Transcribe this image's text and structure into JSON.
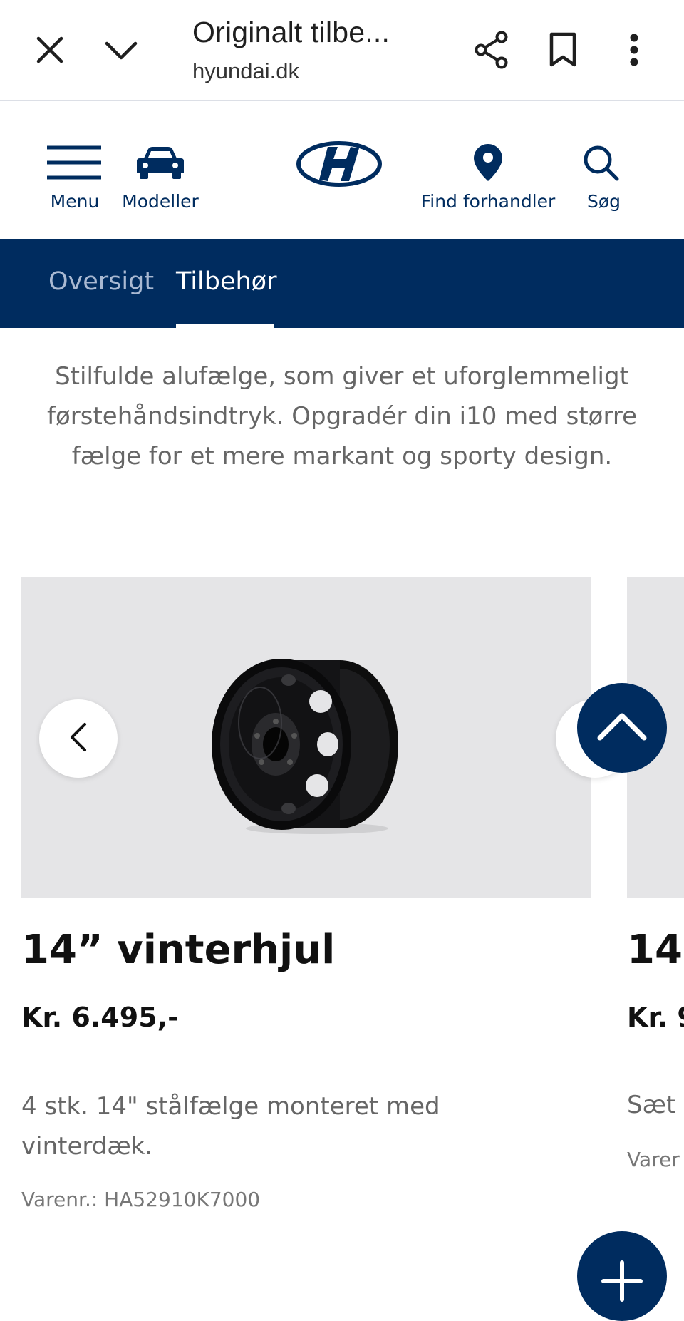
{
  "browser": {
    "title": "Originalt tilbe...",
    "url": "hyundai.dk",
    "icons": [
      "close-icon",
      "chevron-down-icon",
      "share-icon",
      "bookmark-icon",
      "more-vert-icon"
    ]
  },
  "header": {
    "menu_label": "Menu",
    "models_label": "Modeller",
    "dealer_label": "Find forhandler",
    "search_label": "Søg",
    "brand_color": "#002c5f"
  },
  "subnav": {
    "tabs": [
      {
        "label": "Oversigt",
        "active": false
      },
      {
        "label": "Tilbehør",
        "active": true
      }
    ]
  },
  "intro": {
    "text": "Stilfulde alufælge, som giver et uforglemmeligt førstehåndsindtryk. Opgradér din i10 med større fælge for et mere markant og sporty design."
  },
  "products": [
    {
      "title": "14” vinterhjul",
      "price": "Kr. 6.495,-",
      "description": "4 stk. 14\" stålfælge monteret med vinterdæk.",
      "sku": "Varenr.: HA52910K7000"
    },
    {
      "title_partial": "14'",
      "price_partial": "Kr. 9",
      "description_partial": "Sæt",
      "sku_partial": "Varer"
    }
  ]
}
